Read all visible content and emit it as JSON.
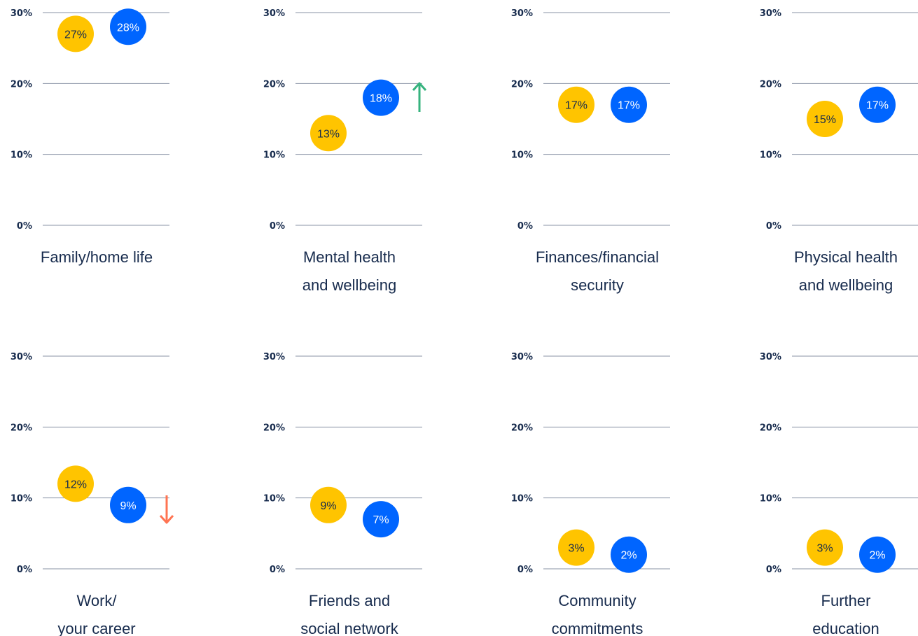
{
  "chart_data": {
    "type": "scatter",
    "ylim": [
      0,
      30
    ],
    "y_ticks": [
      "0%",
      "10%",
      "20%",
      "30%"
    ],
    "colors": {
      "yellow": "#FFC400",
      "blue": "#0065FF",
      "up_arrow": "#36B37E",
      "down_arrow": "#FF7452",
      "text": "#172B4D",
      "grid": "#8993A4"
    },
    "panels": [
      {
        "label": [
          "Family/home life"
        ],
        "values": [
          27,
          28
        ],
        "labels": [
          "27%",
          "28%"
        ],
        "trend": null
      },
      {
        "label": [
          "Mental health",
          "and wellbeing"
        ],
        "values": [
          13,
          18
        ],
        "labels": [
          "13%",
          "18%"
        ],
        "trend": "up"
      },
      {
        "label": [
          "Finances/financial",
          "security"
        ],
        "values": [
          17,
          17
        ],
        "labels": [
          "17%",
          "17%"
        ],
        "trend": null
      },
      {
        "label": [
          "Physical health",
          "and wellbeing"
        ],
        "values": [
          15,
          17
        ],
        "labels": [
          "15%",
          "17%"
        ],
        "trend": null
      },
      {
        "label": [
          "Work/",
          "your career"
        ],
        "values": [
          12,
          9
        ],
        "labels": [
          "12%",
          "9%"
        ],
        "trend": "down"
      },
      {
        "label": [
          "Friends and",
          "social network"
        ],
        "values": [
          9,
          7
        ],
        "labels": [
          "9%",
          "7%"
        ],
        "trend": null
      },
      {
        "label": [
          "Community",
          "commitments"
        ],
        "values": [
          3,
          2
        ],
        "labels": [
          "3%",
          "2%"
        ],
        "trend": null
      },
      {
        "label": [
          "Further",
          "education"
        ],
        "values": [
          3,
          2
        ],
        "labels": [
          "3%",
          "2%"
        ],
        "trend": null
      }
    ]
  }
}
